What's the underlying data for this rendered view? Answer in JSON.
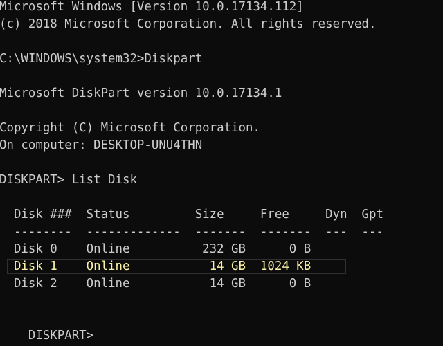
{
  "console": {
    "lines": {
      "header_version": "Microsoft Windows [Version 10.0.17134.112]",
      "header_copyright": "(c) 2018 Microsoft Corporation. All rights reserved.",
      "command_diskpart": "C:\\WINDOWS\\system32>Diskpart",
      "diskpart_version": "Microsoft DiskPart version 10.0.17134.1",
      "diskpart_copyright": "Copyright (C) Microsoft Corporation.",
      "computer_name": "On computer: DESKTOP-UNU4THN",
      "command_list_disk": "DISKPART> List Disk",
      "table_header": "  Disk ###  Status         Size     Free     Dyn  Gpt",
      "table_separator": "  --------  -------------  -------  -------  ---  ---",
      "prompt": "DISKPART> "
    },
    "disks": [
      {
        "row": "  Disk 0    Online          232 GB      0 B"
      },
      {
        "row": "  Disk 1    Online           14 GB  1024 KB"
      },
      {
        "row": "  Disk 2    Online           14 GB      0 B"
      }
    ],
    "colors": {
      "background": "#0c0c0c",
      "text": "#cccccc",
      "highlight_text": "#f9f1a5"
    }
  }
}
